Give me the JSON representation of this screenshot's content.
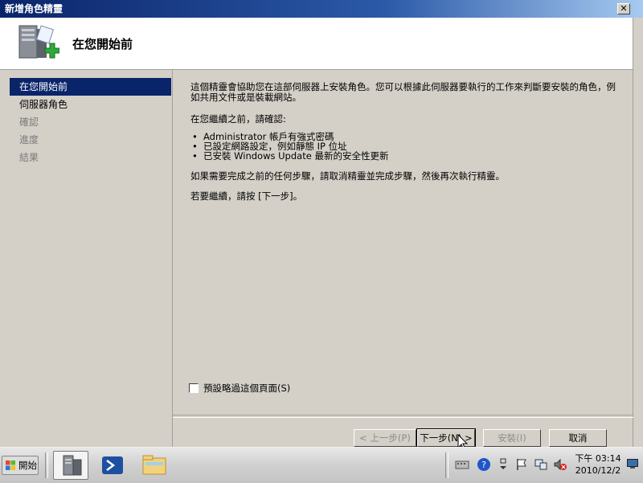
{
  "window": {
    "title": "新增角色精靈",
    "close_symbol": "✕"
  },
  "header": {
    "title": "在您開始前"
  },
  "sidebar": {
    "items": [
      {
        "label": "在您開始前",
        "state": "active"
      },
      {
        "label": "伺服器角色",
        "state": "enabled"
      },
      {
        "label": "確認",
        "state": "disabled"
      },
      {
        "label": "進度",
        "state": "disabled"
      },
      {
        "label": "結果",
        "state": "disabled"
      }
    ]
  },
  "content": {
    "intro": "這個精靈會協助您在這部伺服器上安裝角色。您可以根據此伺服器要執行的工作來判斷要安裝的角色，例如共用文件或是裝載網站。",
    "confirm_heading": "在您繼續之前，請確認:",
    "bullets": [
      "Administrator 帳戶有強式密碼",
      "已設定網路設定，例如靜態 IP 位址",
      "已安裝 Windows Update 最新的安全性更新"
    ],
    "cancel_note": "如果需要完成之前的任何步驟，請取消精靈並完成步驟，然後再次執行精靈。",
    "continue_note": "若要繼續，請按 [下一步]。",
    "skip_checkbox": {
      "label": "預設略過這個頁面(S)",
      "checked": false
    }
  },
  "buttons": {
    "back": "< 上一步(P)",
    "next": "下一步(N) >",
    "install": "安裝(I)",
    "cancel": "取消"
  },
  "taskbar": {
    "start_label": "開始",
    "clock_time": "下午 03:14",
    "clock_date": "2010/12/2"
  },
  "colors": {
    "selection": "#0a246a",
    "titlebar": "#0a246a",
    "install_cross": "#2eaa3a"
  }
}
